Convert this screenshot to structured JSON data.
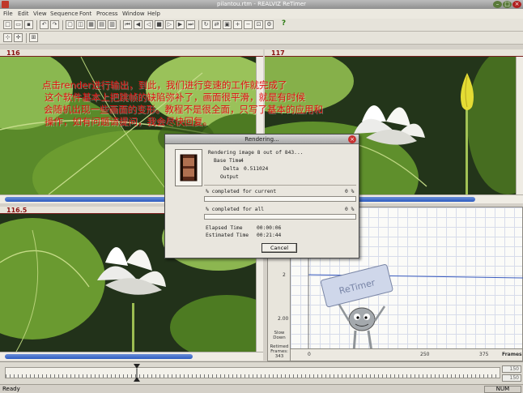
{
  "window": {
    "title": "pilantou.rtm - REALVIZ ReTimer",
    "min": "–",
    "max": "□",
    "close": "×"
  },
  "menu": [
    "File",
    "Edit",
    "View",
    "Sequence",
    "Font",
    "Process",
    "Window",
    "Help"
  ],
  "viewers": {
    "top_left_frame": "116",
    "top_right_frame": "117",
    "bottom_left_frame": "116.5"
  },
  "overlay_text": [
    "点击render进行输出，到此，我们进行变速的工作就完成了",
    "这个软件基本上把跳帧的缺陷弥补了，画面很平滑，就是有时候",
    "会随机出现一些画面的变形。教程不是很全面，只写了基本的应用和",
    "操作，如有问题请提问，我会尽快回复。"
  ],
  "dialog": {
    "title": "Rendering...",
    "close": "×",
    "rendering_line": "Rendering image 8 out of 843...",
    "base_time_label": "Base Time",
    "base_time_value": "4",
    "delta_label": "Delta",
    "delta_value": "0.511024",
    "output_label": "Output",
    "completed_current_label": "% completed for current",
    "completed_current_value": "0 %",
    "completed_current_fraction": 0,
    "completed_all_label": "% completed for all",
    "completed_all_value": "0 %",
    "completed_all_fraction": 0,
    "elapsed_label": "Elapsed Time",
    "elapsed_value": "00:00:06",
    "estimated_label": "Estimated Time",
    "estimated_value": "00:21:44",
    "cancel_label": "Cancel"
  },
  "graph": {
    "y_ticks": [
      "2",
      "2.00"
    ],
    "x_ticks": [
      "0",
      "250",
      "375"
    ],
    "x_label": "Frames",
    "slow_down_label": [
      "Slow",
      "Down"
    ],
    "retimed_frames_label": [
      "Retimed",
      "Frames:",
      "343"
    ],
    "mascot_card_text": "ReTimer"
  },
  "timeline": {
    "field_top": "150",
    "field_bottom": "150"
  },
  "status": {
    "left": "Ready",
    "right": "NUM"
  },
  "colors": {
    "overlay_text": "#e01010",
    "frame_label": "#8a1010",
    "scroll_thumb": "#2d5cc0"
  }
}
